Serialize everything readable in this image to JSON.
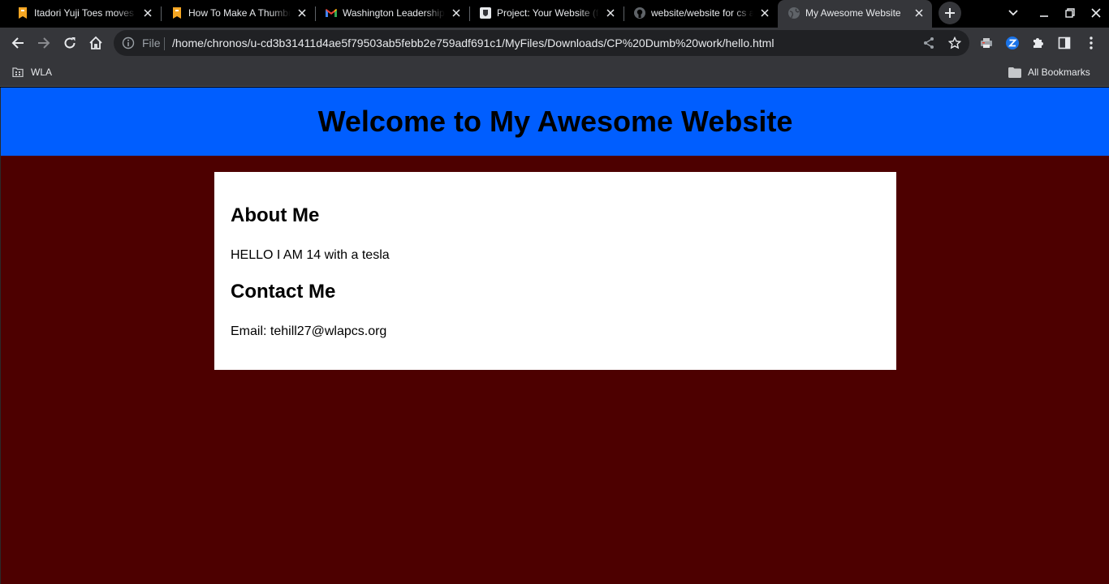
{
  "tabs": [
    {
      "title": "Itadori Yuji Toes moves",
      "icon": "bookmark-orange-icon"
    },
    {
      "title": "How To Make A Thumbnail",
      "icon": "bookmark-orange-icon"
    },
    {
      "title": "Washington Leadership",
      "icon": "gmail-icon"
    },
    {
      "title": "Project: Your Website (f",
      "icon": "classroom-shield-icon"
    },
    {
      "title": "website/website for cs a",
      "icon": "github-icon"
    },
    {
      "title": "My Awesome Website",
      "icon": "globe-icon",
      "active": true
    }
  ],
  "omnibox": {
    "scheme_label": "File",
    "url": "/home/chronos/u-cd3b31411d4ae5f79503ab5febb2e759adf691c1/MyFiles/Downloads/CP%20Dumb%20work/hello.html"
  },
  "bookmarks": {
    "left": [
      {
        "label": "WLA",
        "icon": "folder-apps-icon"
      }
    ],
    "right": [
      {
        "label": "All Bookmarks",
        "icon": "folder-icon"
      }
    ]
  },
  "page": {
    "header_title": "Welcome to My Awesome Website",
    "about": {
      "heading": "About Me",
      "text": "HELLO I AM 14 with a tesla"
    },
    "contact": {
      "heading": "Contact Me",
      "text": "Email: tehill27@wlapcs.org"
    },
    "colors": {
      "header_bg": "#005eff",
      "page_bg": "#4d0000",
      "card_bg": "#ffffff"
    }
  }
}
